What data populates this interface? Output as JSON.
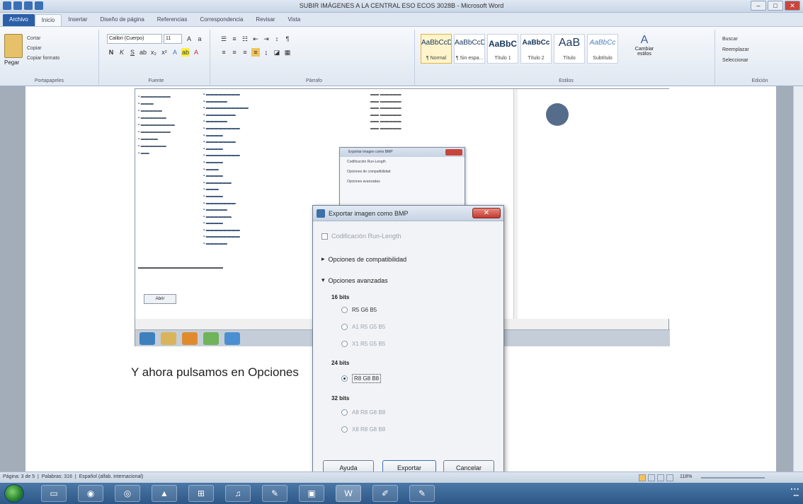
{
  "window": {
    "title": "SUBIR IMÁGENES A LA CENTRAL ESO ECOS 3028B - Microsoft Word"
  },
  "ribbon": {
    "tabs": [
      "Archivo",
      "Inicio",
      "Insertar",
      "Diseño de página",
      "Referencias",
      "Correspondencia",
      "Revisar",
      "Vista"
    ],
    "clipboard": {
      "paste": "Pegar",
      "cut": "Cortar",
      "copy": "Copiar",
      "format_painter": "Copiar formato",
      "group": "Portapapeles"
    },
    "font": {
      "name": "Calibri (Cuerpo)",
      "size": "11",
      "group": "Fuente"
    },
    "paragraph": {
      "group": "Párrafo"
    },
    "styles": {
      "group": "Estilos",
      "items": [
        {
          "sample": "AaBbCcDc",
          "name": "¶ Normal"
        },
        {
          "sample": "AaBbCcDc",
          "name": "¶ Sin espa..."
        },
        {
          "sample": "AaBbC",
          "name": "Título 1"
        },
        {
          "sample": "AaBbCc",
          "name": "Título 2"
        },
        {
          "sample": "AaB",
          "name": "Título"
        },
        {
          "sample": "AaBbCc",
          "name": "Subtítulo"
        }
      ],
      "change": "Cambiar estilos"
    },
    "editing": {
      "group": "Edición",
      "find": "Buscar",
      "replace": "Reemplazar",
      "select": "Seleccionar"
    }
  },
  "embedded": {
    "dialog_small": {
      "title": "Exportar imagen como BMP",
      "rows": [
        "Codificación Run-Length",
        "Opciones de compatibilidad",
        "Opciones avanzadas"
      ]
    },
    "explorer_button": "Abrir"
  },
  "dialog": {
    "title": "Exportar imagen como BMP",
    "close": "✕",
    "rle": "Codificación Run-Length",
    "compat": "Opciones de compatibilidad",
    "advanced": "Opciones avanzadas",
    "bits16": "16 bits",
    "bits16_opts": [
      "R5 G6 B5",
      "A1 R5 G5 B5",
      "X1 R5 G5 B5"
    ],
    "bits24": "24 bits",
    "bits24_opts": [
      "R8 G8 B8"
    ],
    "bits32": "32 bits",
    "bits32_opts": [
      "A8 R8 G8 B8",
      "X8 R8 G8 B8"
    ],
    "buttons": {
      "help": "Ayuda",
      "export": "Exportar",
      "cancel": "Cancelar"
    }
  },
  "document": {
    "caption": "Y ahora pulsamos en Opciones"
  },
  "statusbar": {
    "page": "Página: 3 de 5",
    "words": "Palabras: 316",
    "language": "Español (alfab. internacional)",
    "zoom": "118%"
  }
}
